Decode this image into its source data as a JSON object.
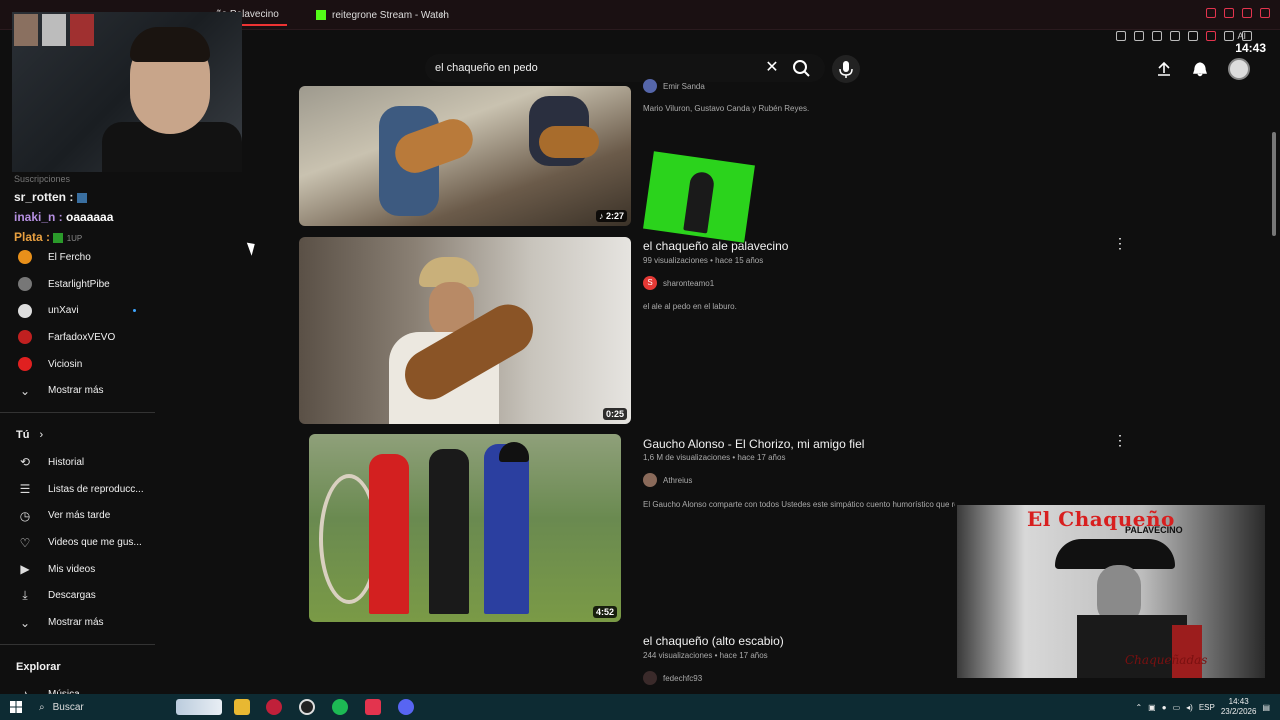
{
  "browser": {
    "tabs": [
      {
        "label": "ño Palavecino",
        "active": true
      },
      {
        "label": "reitegrone Stream - Watch",
        "active": false
      }
    ],
    "new_tab": "+",
    "ai_label": "AI",
    "clock": "14:43"
  },
  "search": {
    "value": "el chaqueño en pedo"
  },
  "chat": {
    "faint_header": "Suscripciones",
    "messages": [
      {
        "user": "sr_rotten :",
        "text": ""
      },
      {
        "user": "inaki_n :",
        "text": "oaaaaaa"
      },
      {
        "user": "Plata :",
        "text": "",
        "badge": "1UP"
      }
    ]
  },
  "sidebar": {
    "subscriptions": [
      {
        "label": "El Fercho",
        "color": "#e8901a"
      },
      {
        "label": "EstarlightPibe",
        "color": "#777777"
      },
      {
        "label": "unXavi",
        "color": "#dddddd",
        "live": true
      },
      {
        "label": "FarfadoxVEVO",
        "color": "#c02020"
      },
      {
        "label": "Viciosin",
        "color": "#e02020"
      }
    ],
    "show_more_1": "Mostrar más",
    "you_title": "Tú",
    "you_items": [
      {
        "label": "Historial",
        "icon": "history-icon",
        "glyph": "⟲"
      },
      {
        "label": "Listas de reproducc...",
        "icon": "playlist-icon",
        "glyph": "☰"
      },
      {
        "label": "Ver más tarde",
        "icon": "clock-icon",
        "glyph": "◷"
      },
      {
        "label": "Videos que me gus...",
        "icon": "thumbs-up-icon",
        "glyph": "👍"
      },
      {
        "label": "Mis videos",
        "icon": "my-videos-icon",
        "glyph": "▶"
      },
      {
        "label": "Descargas",
        "icon": "download-icon",
        "glyph": "⤓"
      }
    ],
    "show_more_2": "Mostrar más",
    "explore_title": "Explorar",
    "explore_items": [
      {
        "label": "Música",
        "icon": "music-icon",
        "glyph": "♪"
      }
    ]
  },
  "results": [
    {
      "title": "",
      "channel": "Emir Sanda",
      "desc": "Mario Viluron, Gustavo Canda y Rubén Reyes.",
      "duration": "♪ 2:27"
    },
    {
      "title": "el chaqueño ale palavecino",
      "meta": "99 visualizaciones • hace 15 años",
      "channel": "sharonteamo1",
      "channel_initial": "S",
      "desc": "el ale al pedo en el laburo.",
      "duration": "0:25"
    },
    {
      "title": "Gaucho Alonso - El Chorizo, mi amigo fiel",
      "meta": "1,6 M de visualizaciones • hace 17 años",
      "channel": "Athreius",
      "desc": "El Gaucho Alonso comparte con todos Ustedes este simpático cuento humorístico que relata la historia de un perro llamado",
      "duration": "4:52"
    },
    {
      "title": "el chaqueño (alto escabio)",
      "meta": "244 visualizaciones • hace 17 años",
      "channel": "fedechfc93"
    }
  ],
  "album": {
    "title": "El Chaqueño",
    "subtitle": "PALAVECINO",
    "script": "Chaqueñadas"
  },
  "taskbar": {
    "search_label": "Buscar",
    "lang": "ESP",
    "time": "14:43",
    "date": "23/2/2026"
  }
}
